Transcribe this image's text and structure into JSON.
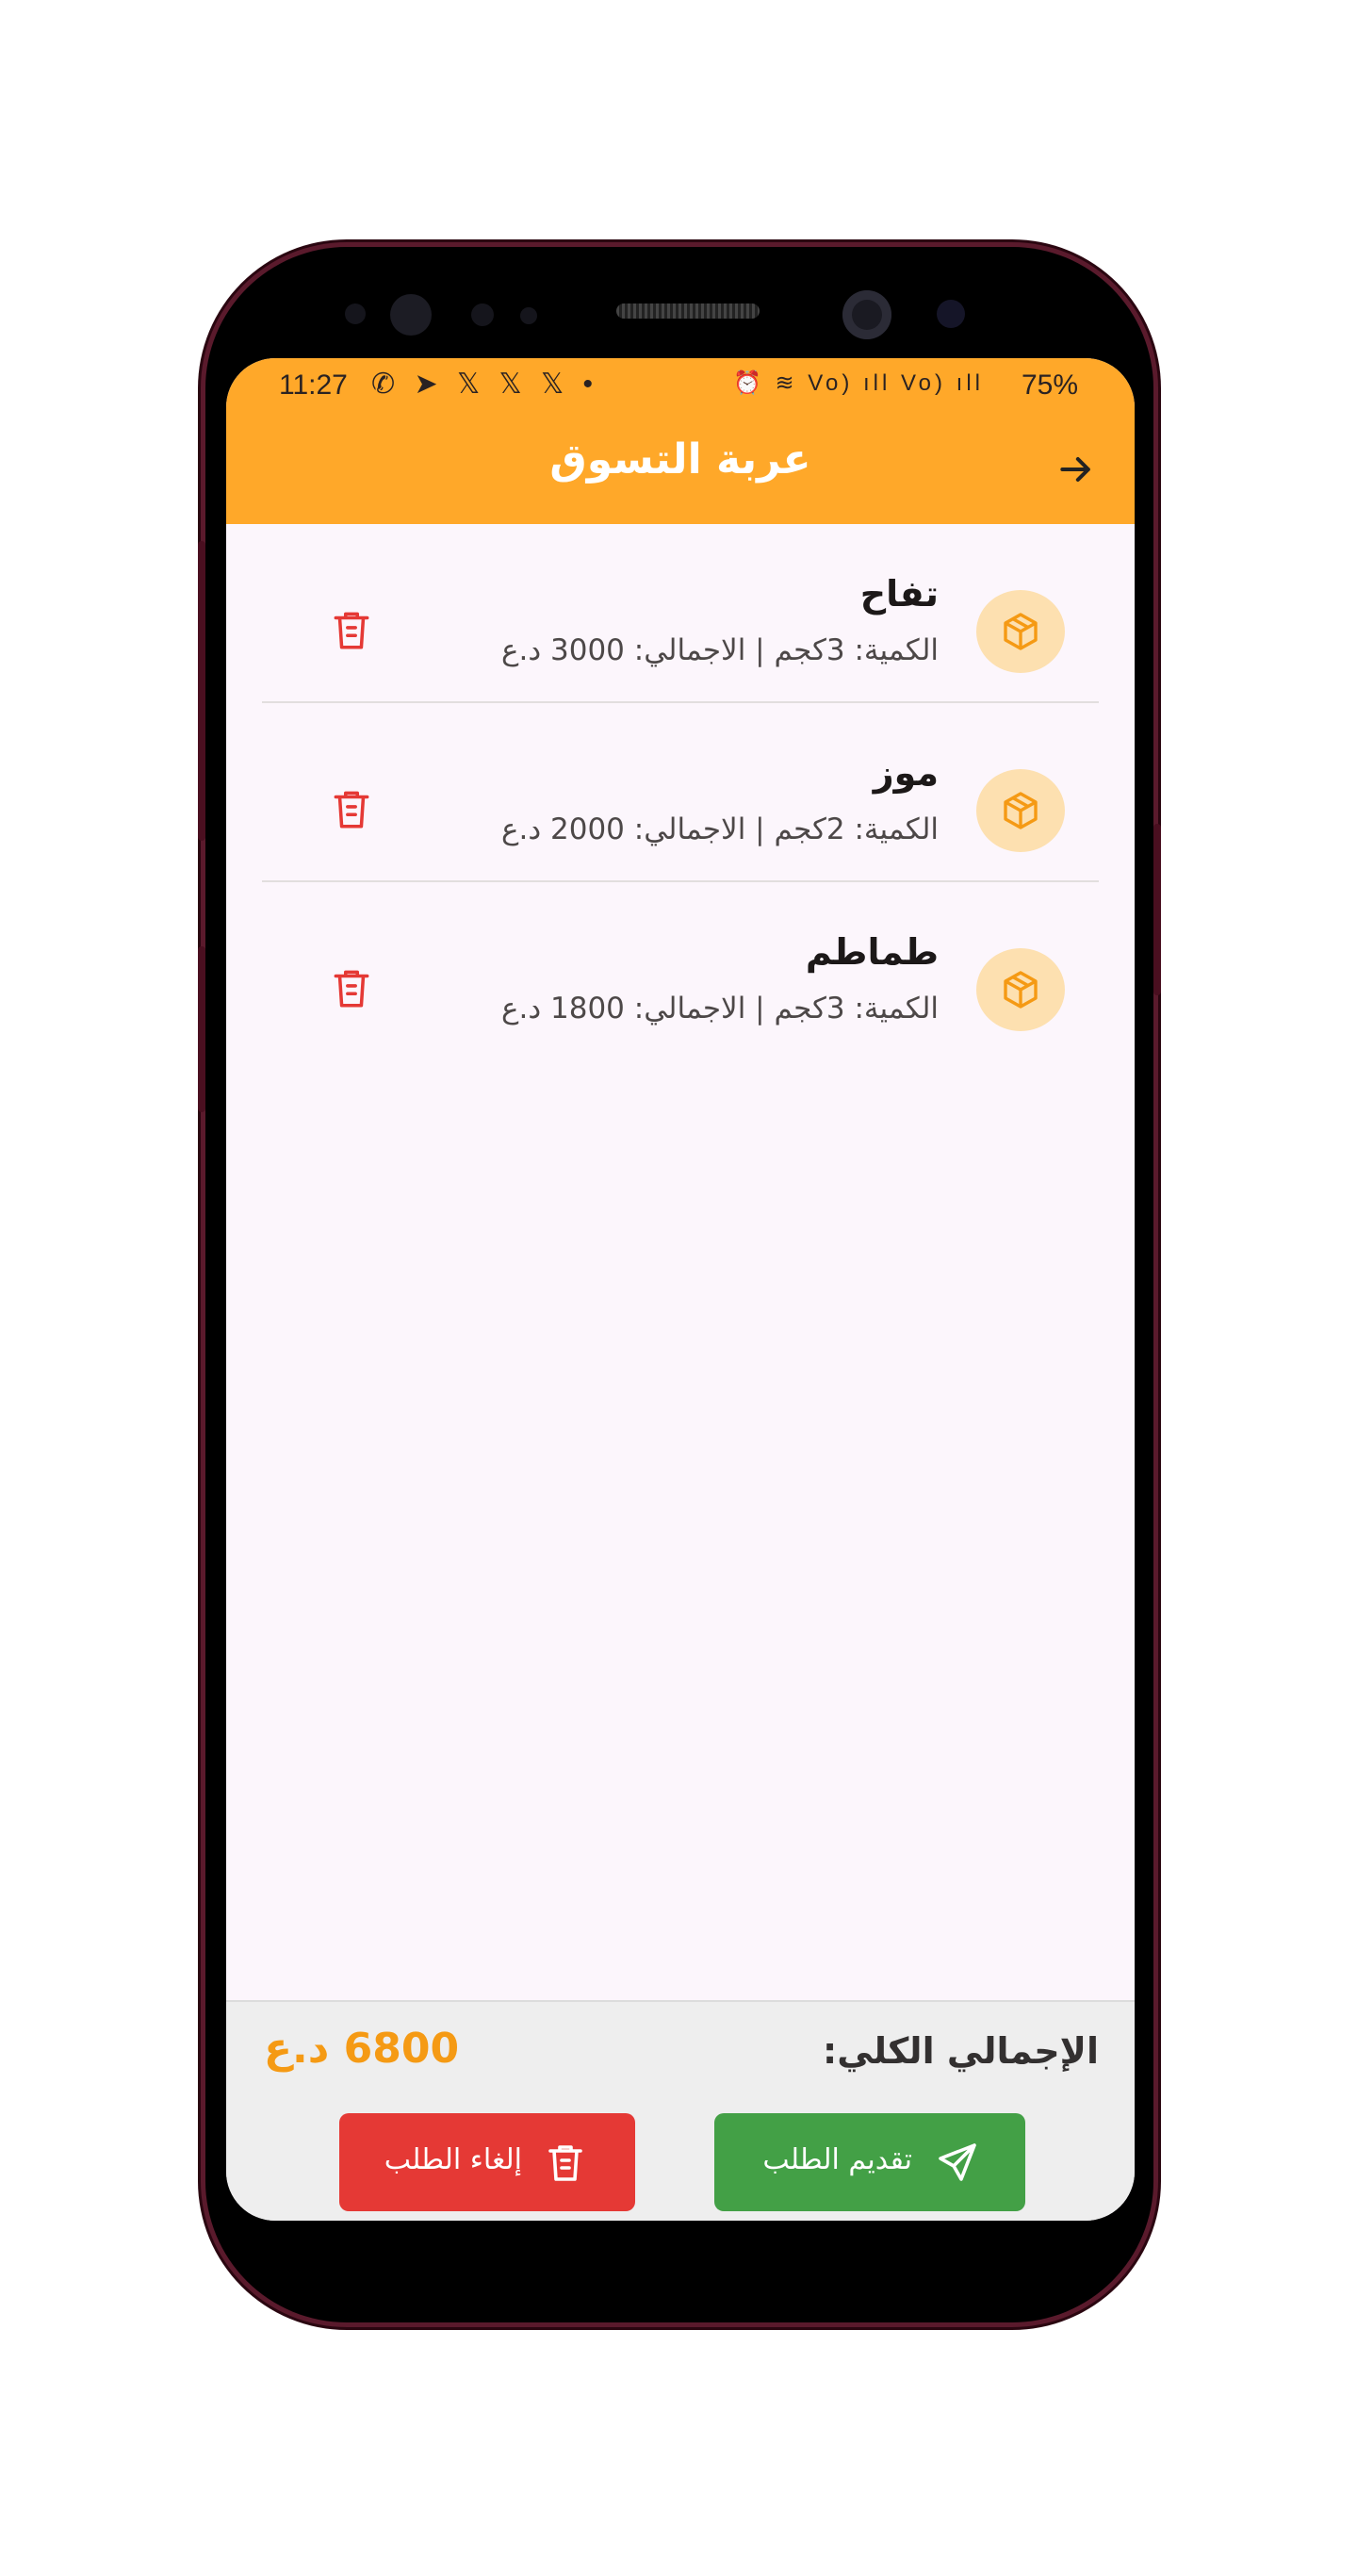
{
  "status_bar": {
    "time": "11:27",
    "left_icons": "✆ ➤ 𝕏 𝕏 𝕏 •",
    "right_icons": "⏰ ≋ Vo) ıll Vo) ıll",
    "battery": "75%"
  },
  "app_bar": {
    "title": "عربة التسوق",
    "back_icon": "arrow-right-icon"
  },
  "cart": {
    "items": [
      {
        "name": "تفاح",
        "detail": "الكمية: 3كجم | الاجمالي: 3000 د.ع"
      },
      {
        "name": "موز",
        "detail": "الكمية: 2كجم | الاجمالي: 2000 د.ع"
      },
      {
        "name": "طماطم",
        "detail": "الكمية: 3كجم | الاجمالي: 1800 د.ع"
      }
    ]
  },
  "footer": {
    "total_label": "الإجمالي الكلي:",
    "total_value": "6800 د.ع",
    "submit_label": "تقديم الطلب",
    "cancel_label": "إلغاء الطلب"
  },
  "colors": {
    "accent": "#ffa829",
    "submit": "#43a046",
    "cancel": "#e53935",
    "total": "#f59a14"
  }
}
